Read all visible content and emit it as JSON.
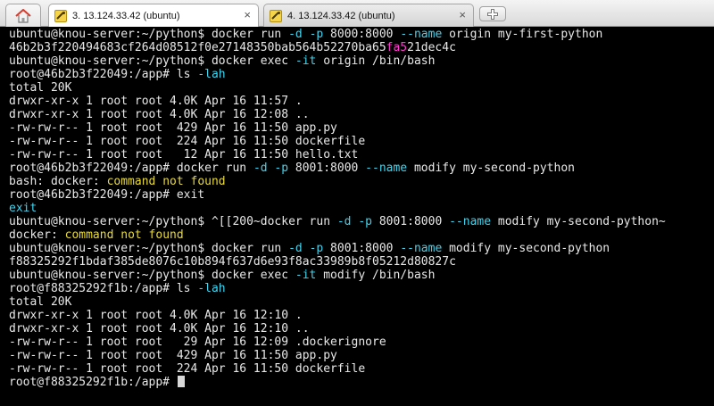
{
  "tabs": [
    {
      "title": "3. 13.124.33.42 (ubuntu)",
      "active": true,
      "close": "×"
    },
    {
      "title": "4. 13.124.33.42 (ubuntu)",
      "active": false,
      "close": "×"
    }
  ],
  "colors": {
    "cyan": "#3fd4ee",
    "yellow": "#e8d93a",
    "magenta": "#ff3ed1",
    "text": "#e8e8e8"
  },
  "terminal": {
    "lines": [
      [
        {
          "t": "ubuntu@knou-server:~/python$ docker run "
        },
        {
          "t": "-d",
          "c": "cyan"
        },
        {
          "t": " "
        },
        {
          "t": "-p",
          "c": "cyan"
        },
        {
          "t": " 8000:8000 "
        },
        {
          "t": "--name",
          "c": "cyan"
        },
        {
          "t": " origin my-first-python"
        }
      ],
      [
        {
          "t": "46b2b3f220494683cf264d08512f0e27148350bab564b52270ba65"
        },
        {
          "t": "fa5",
          "c": "magenta"
        },
        {
          "t": "21dec4c"
        }
      ],
      [
        {
          "t": "ubuntu@knou-server:~/python$ docker exec "
        },
        {
          "t": "-it",
          "c": "cyan"
        },
        {
          "t": " origin /bin/bash"
        }
      ],
      [
        {
          "t": "root@46b2b3f22049:/app# ls "
        },
        {
          "t": "-lah",
          "c": "cyan"
        }
      ],
      [
        {
          "t": "total 20K"
        }
      ],
      [
        {
          "t": "drwxr-xr-x 1 root root 4.0K Apr 16 11:57 ."
        }
      ],
      [
        {
          "t": "drwxr-xr-x 1 root root 4.0K Apr 16 12:08 .."
        }
      ],
      [
        {
          "t": "-rw-rw-r-- 1 root root  429 Apr 16 11:50 app.py"
        }
      ],
      [
        {
          "t": "-rw-rw-r-- 1 root root  224 Apr 16 11:50 dockerfile"
        }
      ],
      [
        {
          "t": "-rw-rw-r-- 1 root root   12 Apr 16 11:50 hello.txt"
        }
      ],
      [
        {
          "t": "root@46b2b3f22049:/app# docker run "
        },
        {
          "t": "-d",
          "c": "cyan"
        },
        {
          "t": " "
        },
        {
          "t": "-p",
          "c": "cyan"
        },
        {
          "t": " 8001:8000 "
        },
        {
          "t": "--name",
          "c": "cyan"
        },
        {
          "t": " modify my-second-python"
        }
      ],
      [
        {
          "t": "bash: docker: "
        },
        {
          "t": "command not found",
          "c": "yellow"
        }
      ],
      [
        {
          "t": "root@46b2b3f22049:/app# exit"
        }
      ],
      [
        {
          "t": "exit",
          "c": "cyan"
        }
      ],
      [
        {
          "t": "ubuntu@knou-server:~/python$ ^[[200~docker run "
        },
        {
          "t": "-d",
          "c": "cyan"
        },
        {
          "t": " "
        },
        {
          "t": "-p",
          "c": "cyan"
        },
        {
          "t": " 8001:8000 "
        },
        {
          "t": "--name",
          "c": "cyan"
        },
        {
          "t": " modify my-second-python~"
        }
      ],
      [
        {
          "t": "docker: "
        },
        {
          "t": "command not found",
          "c": "yellow"
        }
      ],
      [
        {
          "t": "ubuntu@knou-server:~/python$ docker run "
        },
        {
          "t": "-d",
          "c": "cyan"
        },
        {
          "t": " "
        },
        {
          "t": "-p",
          "c": "cyan"
        },
        {
          "t": " 8001:8000 "
        },
        {
          "t": "--name",
          "c": "cyan"
        },
        {
          "t": " modify my-second-python"
        }
      ],
      [
        {
          "t": "f88325292f1bdaf385de8076c10b894f637d6e93f8ac33989b8f05212d80827c"
        }
      ],
      [
        {
          "t": "ubuntu@knou-server:~/python$ docker exec "
        },
        {
          "t": "-it",
          "c": "cyan"
        },
        {
          "t": " modify /bin/bash"
        }
      ],
      [
        {
          "t": "root@f88325292f1b:/app# ls "
        },
        {
          "t": "-lah",
          "c": "cyan"
        }
      ],
      [
        {
          "t": "total 20K"
        }
      ],
      [
        {
          "t": "drwxr-xr-x 1 root root 4.0K Apr 16 12:10 ."
        }
      ],
      [
        {
          "t": "drwxr-xr-x 1 root root 4.0K Apr 16 12:10 .."
        }
      ],
      [
        {
          "t": "-rw-rw-r-- 1 root root   29 Apr 16 12:09 .dockerignore"
        }
      ],
      [
        {
          "t": "-rw-rw-r-- 1 root root  429 Apr 16 11:50 app.py"
        }
      ],
      [
        {
          "t": "-rw-rw-r-- 1 root root  224 Apr 16 11:50 dockerfile"
        }
      ],
      [
        {
          "t": "root@f88325292f1b:/app# "
        }
      ]
    ]
  }
}
